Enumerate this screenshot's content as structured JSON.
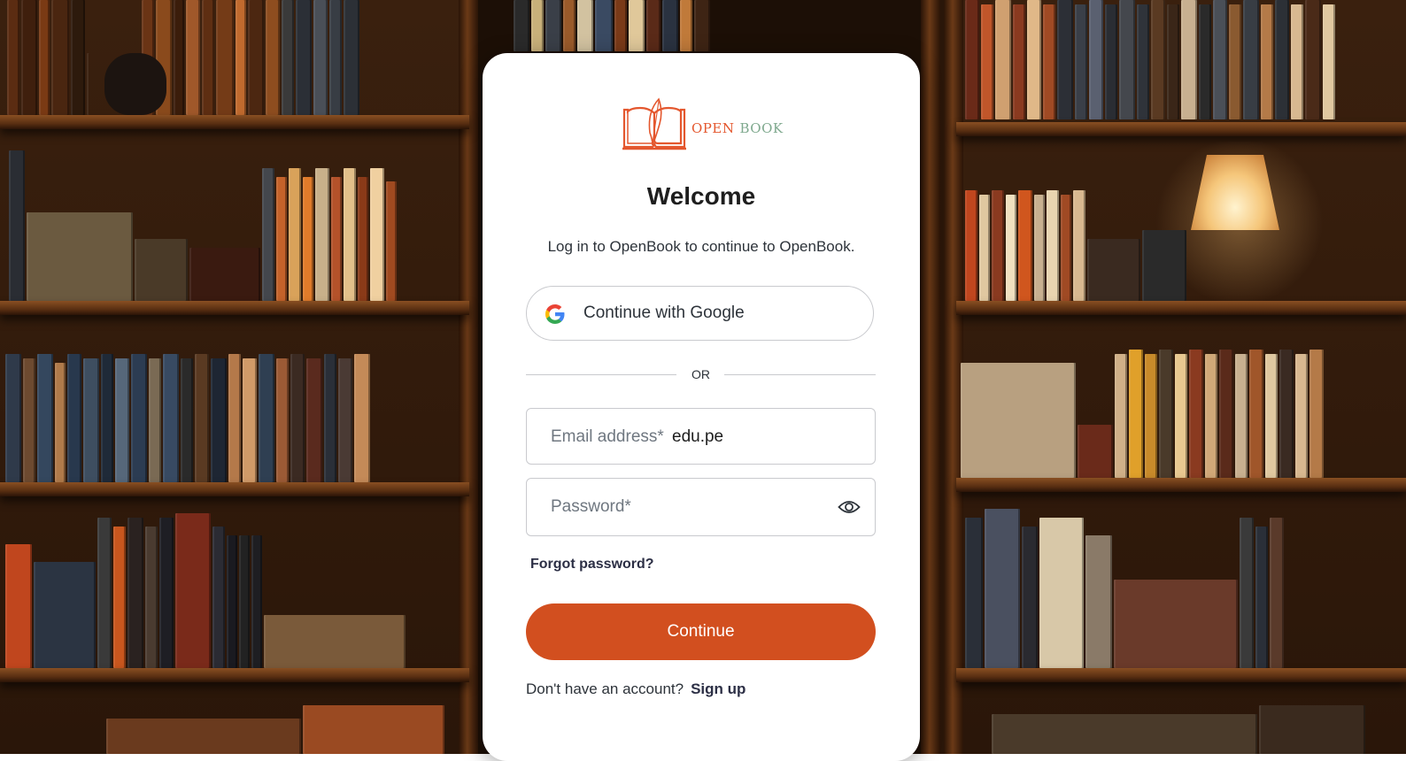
{
  "brand": {
    "open": "OPEN",
    "book": "BOOK",
    "open_color": "#e4572e",
    "book_color": "#7fa98e"
  },
  "login": {
    "title": "Welcome",
    "subtitle": "Log in to OpenBook to continue to OpenBook.",
    "google_label": "Continue with Google",
    "divider": "OR",
    "email_label": "Email address*",
    "email_value": "edu.pe",
    "password_label": "Password*",
    "forgot": "Forgot password?",
    "continue_label": "Continue",
    "no_account": "Don't have an account?",
    "signup": "Sign up",
    "accent_color": "#d24f1f",
    "eye_icon": "eye-icon",
    "google_icon": "google-icon"
  }
}
